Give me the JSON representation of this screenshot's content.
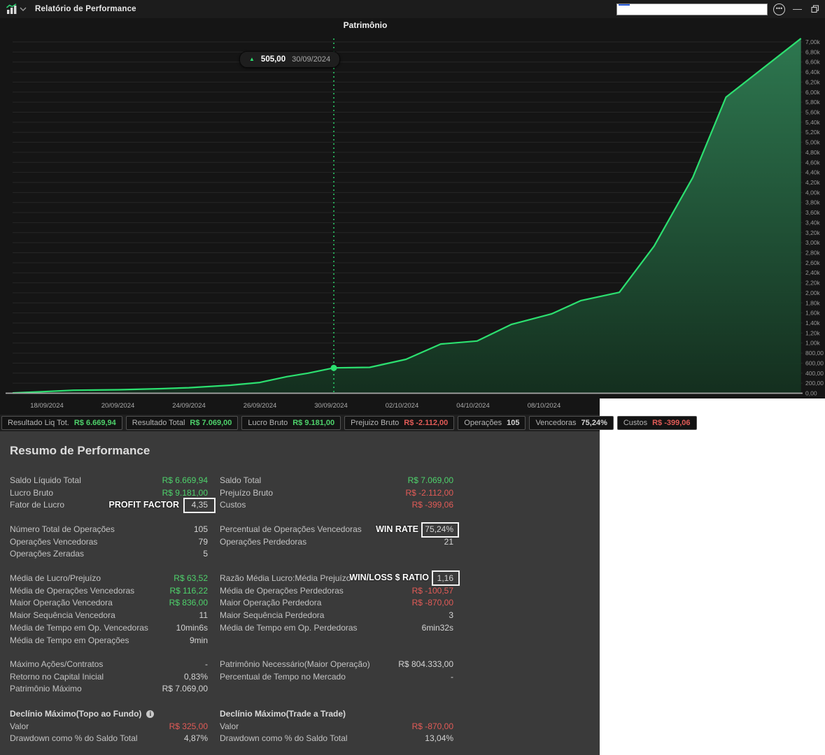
{
  "titlebar": {
    "title": "Relatório de Performance",
    "controls": {
      "more": "more-options",
      "minimize": "minimize",
      "restore": "restore"
    }
  },
  "chart_data": {
    "type": "area",
    "title": "Patrimônio",
    "currency": "R$",
    "ylim": [
      0,
      7000
    ],
    "grid": true,
    "y_ticks": [
      "0,00",
      "200,00",
      "400,00",
      "600,00",
      "800,00",
      "1,00k",
      "1,20k",
      "1,40k",
      "1,60k",
      "1,80k",
      "2,00k",
      "2,20k",
      "2,40k",
      "2,60k",
      "2,80k",
      "3,00k",
      "3,20k",
      "3,40k",
      "3,60k",
      "3,80k",
      "4,00k",
      "4,20k",
      "4,40k",
      "4,60k",
      "4,80k",
      "5,00k",
      "5,20k",
      "5,40k",
      "5,60k",
      "5,80k",
      "6,00k",
      "6,20k",
      "6,40k",
      "6,60k",
      "6,80k",
      "7,00k"
    ],
    "y_tick_step": 200,
    "x_ticks": [
      {
        "f": 0.0434,
        "label": "18/09/2024"
      },
      {
        "f": 0.1333,
        "label": "20/09/2024"
      },
      {
        "f": 0.2232,
        "label": "24/09/2024"
      },
      {
        "f": 0.3131,
        "label": "26/09/2024"
      },
      {
        "f": 0.403,
        "label": "30/09/2024"
      },
      {
        "f": 0.4929,
        "label": "02/10/2024"
      },
      {
        "f": 0.5828,
        "label": "04/10/2024"
      },
      {
        "f": 0.6727,
        "label": "08/10/2024"
      }
    ],
    "series": [
      {
        "name": "Patrimônio",
        "points": [
          [
            0.0,
            5
          ],
          [
            0.037,
            30
          ],
          [
            0.077,
            60
          ],
          [
            0.135,
            70
          ],
          [
            0.188,
            90
          ],
          [
            0.223,
            110
          ],
          [
            0.276,
            160
          ],
          [
            0.313,
            215
          ],
          [
            0.347,
            330
          ],
          [
            0.374,
            400
          ],
          [
            0.4066,
            505
          ],
          [
            0.452,
            515
          ],
          [
            0.498,
            675
          ],
          [
            0.542,
            980
          ],
          [
            0.588,
            1040
          ],
          [
            0.631,
            1370
          ],
          [
            0.682,
            1580
          ],
          [
            0.719,
            1845
          ],
          [
            0.768,
            2010
          ],
          [
            0.812,
            2930
          ],
          [
            0.861,
            4300
          ],
          [
            0.903,
            5900
          ],
          [
            0.998,
            7069
          ]
        ]
      }
    ],
    "marker": {
      "f": 0.4066,
      "v": 505,
      "tooltip": {
        "value": "505,00",
        "date": "30/09/2024"
      }
    },
    "colors": {
      "line": "#2ce070",
      "fill_top": "#2e7a51",
      "fill_bottom": "#14301f",
      "grid": "#262626",
      "axis_text": "#989898",
      "baseline": "#a8a8a8",
      "background": "#151515"
    }
  },
  "statusbar": {
    "items": [
      {
        "label": "Resultado Liq Tot.",
        "value": "R$ 6.669,94",
        "c": "g"
      },
      {
        "label": "Resultado Total",
        "value": "R$ 7.069,00",
        "c": "g"
      },
      {
        "label": "Lucro Bruto",
        "value": "R$ 9.181,00",
        "c": "g"
      },
      {
        "label": "Prejuizo Bruto",
        "value": "R$ -2.112,00",
        "c": "r"
      },
      {
        "label": "Operações",
        "value": "105",
        "c": "n"
      },
      {
        "label": "Vencedoras",
        "value": "75,24%",
        "c": "n"
      },
      {
        "label": "Custos",
        "value": "R$ -399,06",
        "c": "r"
      }
    ]
  },
  "summary": {
    "heading": "Resumo de Performance",
    "blocks": [
      {
        "rows": [
          {
            "l1": "Saldo Líquido Total",
            "v1": "R$ 6.669,94",
            "c1": "g",
            "l2": "Saldo Total",
            "v2": "R$ 7.069,00",
            "c2": "g"
          },
          {
            "l1": "Lucro Bruto",
            "v1": "R$ 9.181,00",
            "c1": "g",
            "l2": "Prejuízo Bruto",
            "v2": "R$ -2.112,00",
            "c2": "r"
          },
          {
            "l1": "Fator de Lucro",
            "v1": "4,35",
            "c1": "n",
            "l2": "Custos",
            "v2": "R$ -399,06",
            "c2": "r"
          }
        ]
      },
      {
        "rows": [
          {
            "l1": "Número Total de Operações",
            "v1": "105",
            "c1": "n",
            "l2": "Percentual de Operações Vencedoras",
            "v2": "75,24%",
            "c2": "n"
          },
          {
            "l1": "Operações Vencedoras",
            "v1": "79",
            "c1": "n",
            "l2": "Operações Perdedoras",
            "v2": "21",
            "c2": "n"
          },
          {
            "l1": "Operações Zeradas",
            "v1": "5",
            "c1": "n"
          }
        ]
      },
      {
        "rows": [
          {
            "l1": "Média de Lucro/Prejuízo",
            "v1": "R$ 63,52",
            "c1": "g",
            "l2": "Razão Média Lucro:Média Prejuízo",
            "v2": "1,16",
            "c2": "n"
          },
          {
            "l1": "Média de Operações Vencedoras",
            "v1": "R$ 116,22",
            "c1": "g",
            "l2": "Média de Operações Perdedoras",
            "v2": "R$ -100,57",
            "c2": "r"
          },
          {
            "l1": "Maior Operação Vencedora",
            "v1": "R$ 836,00",
            "c1": "g",
            "l2": "Maior Operação Perdedora",
            "v2": "R$ -870,00",
            "c2": "r"
          },
          {
            "l1": "Maior Sequência Vencedora",
            "v1": "11",
            "c1": "n",
            "l2": "Maior Sequência Perdedora",
            "v2": "3",
            "c2": "n"
          },
          {
            "l1": "Média de Tempo em Op. Vencedoras",
            "v1": "10min6s",
            "c1": "n",
            "l2": "Média de Tempo em Op. Perdedoras",
            "v2": "6min32s",
            "c2": "n"
          },
          {
            "l1": "Média de Tempo em Operações",
            "v1": "9min",
            "c1": "n"
          }
        ]
      },
      {
        "rows": [
          {
            "l1": "Máximo Ações/Contratos",
            "v1": "-",
            "c1": "n",
            "l2": "Patrimônio Necessário(Maior Operação)",
            "v2": "R$ 804.333,00",
            "c2": "n"
          },
          {
            "l1": "Retorno no Capital Inicial",
            "v1": "0,83%",
            "c1": "n",
            "l2": "Percentual de Tempo no Mercado",
            "v2": "-",
            "c2": "n"
          },
          {
            "l1": "Patrimônio Máximo",
            "v1": "R$ 7.069,00",
            "c1": "n"
          }
        ]
      },
      {
        "rows": [
          {
            "h1": "Declínio Máximo(Topo ao Fundo)",
            "info": true,
            "h2": "Declínio Máximo(Trade a Trade)"
          },
          {
            "l1": "Valor",
            "v1": "R$ 325,00",
            "c1": "r",
            "l2": "Valor",
            "v2": "R$ -870,00",
            "c2": "r"
          },
          {
            "l1": "Drawdown como % do Saldo Total",
            "v1": "4,87%",
            "c1": "n",
            "l2": "Drawdown como % do Saldo Total",
            "v2": "13,04%",
            "c2": "n"
          }
        ]
      }
    ],
    "annotations": [
      {
        "id": "pf",
        "text": "PROFIT FACTOR"
      },
      {
        "id": "wr",
        "text": "WIN RATE"
      },
      {
        "id": "wl",
        "text": "WIN/LOSS $ RATIO"
      }
    ]
  }
}
